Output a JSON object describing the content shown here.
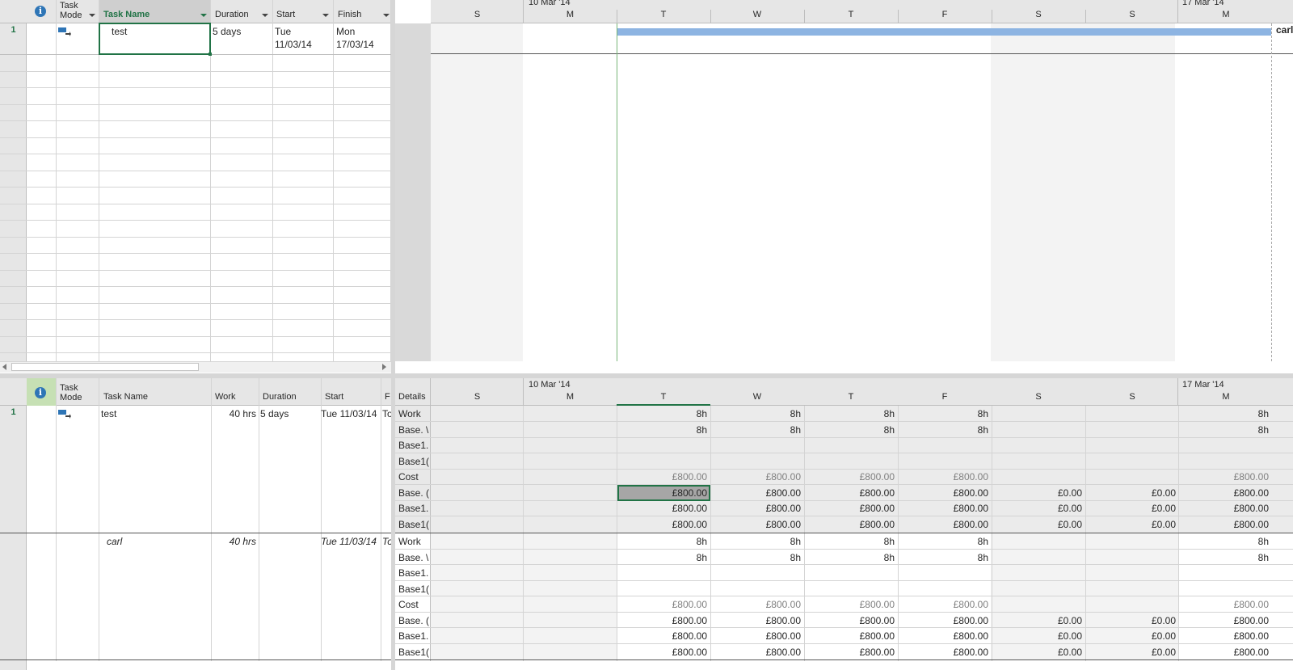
{
  "top_table": {
    "headers": {
      "info": "i",
      "task_mode": "Task Mode",
      "task_name": "Task Name",
      "duration": "Duration",
      "start": "Start",
      "finish": "Finish"
    },
    "row": {
      "id": "1",
      "task_name": "test",
      "duration": "5 days",
      "start_day": "Tue",
      "start_date": "11/03/14",
      "finish_day": "Mon",
      "finish_date": "17/03/14"
    }
  },
  "top_gantt": {
    "week1": "10 Mar '14",
    "week2": "17 Mar '14",
    "days": [
      "S",
      "M",
      "T",
      "W",
      "T",
      "F",
      "S",
      "S",
      "M"
    ],
    "bar_label": "carl"
  },
  "bottom_table": {
    "headers": {
      "info": "i",
      "task_mode": "Task Mode",
      "task_name": "Task Name",
      "work": "Work",
      "duration": "Duration",
      "start": "Start",
      "f": "F"
    },
    "task_row": {
      "id": "1",
      "task_name": "test",
      "work": "40 hrs",
      "duration": "5 days",
      "start": "Tue 11/03/14",
      "f": "To"
    },
    "assignment_row": {
      "task_name": "carl",
      "work": "40 hrs",
      "start": "Tue 11/03/14",
      "f": "To"
    }
  },
  "bottom_usage": {
    "details_label": "Details",
    "week1": "10 Mar '14",
    "week2": "17 Mar '14",
    "days": [
      "S",
      "M",
      "T",
      "W",
      "T",
      "F",
      "S",
      "S",
      "M"
    ],
    "block1": {
      "labels": [
        "Work",
        "Base. \\",
        "Base1.",
        "Base1(",
        "Cost",
        "Base. (",
        "Base1.",
        "Base1("
      ],
      "rows": [
        [
          "",
          "",
          "8h",
          "8h",
          "8h",
          "8h",
          "",
          "",
          "8h"
        ],
        [
          "",
          "",
          "8h",
          "8h",
          "8h",
          "8h",
          "",
          "",
          "8h"
        ],
        [
          "",
          "",
          "",
          "",
          "",
          "",
          "",
          "",
          ""
        ],
        [
          "",
          "",
          "",
          "",
          "",
          "",
          "",
          "",
          ""
        ],
        [
          "",
          "",
          "£800.00",
          "£800.00",
          "£800.00",
          "£800.00",
          "",
          "",
          "£800.00"
        ],
        [
          "",
          "",
          "£800.00",
          "£800.00",
          "£800.00",
          "£800.00",
          "£0.00",
          "£0.00",
          "£800.00"
        ],
        [
          "",
          "",
          "£800.00",
          "£800.00",
          "£800.00",
          "£800.00",
          "£0.00",
          "£0.00",
          "£800.00"
        ],
        [
          "",
          "",
          "£800.00",
          "£800.00",
          "£800.00",
          "£800.00",
          "£0.00",
          "£0.00",
          "£800.00"
        ]
      ]
    },
    "block2": {
      "labels": [
        "Work",
        "Base. \\",
        "Base1.",
        "Base1(",
        "Cost",
        "Base. (",
        "Base1.",
        "Base1("
      ],
      "rows": [
        [
          "",
          "",
          "8h",
          "8h",
          "8h",
          "8h",
          "",
          "",
          "8h"
        ],
        [
          "",
          "",
          "8h",
          "8h",
          "8h",
          "8h",
          "",
          "",
          "8h"
        ],
        [
          "",
          "",
          "",
          "",
          "",
          "",
          "",
          "",
          ""
        ],
        [
          "",
          "",
          "",
          "",
          "",
          "",
          "",
          "",
          ""
        ],
        [
          "",
          "",
          "£800.00",
          "£800.00",
          "£800.00",
          "£800.00",
          "",
          "",
          "£800.00"
        ],
        [
          "",
          "",
          "£800.00",
          "£800.00",
          "£800.00",
          "£800.00",
          "£0.00",
          "£0.00",
          "£800.00"
        ],
        [
          "",
          "",
          "£800.00",
          "£800.00",
          "£800.00",
          "£800.00",
          "£0.00",
          "£0.00",
          "£800.00"
        ],
        [
          "",
          "",
          "£800.00",
          "£800.00",
          "£800.00",
          "£800.00",
          "£0.00",
          "£0.00",
          "£800.00"
        ]
      ]
    }
  },
  "colors": {
    "bar": "#8db4e2",
    "selection": "#217346",
    "header_bg": "#e6e6e6"
  }
}
